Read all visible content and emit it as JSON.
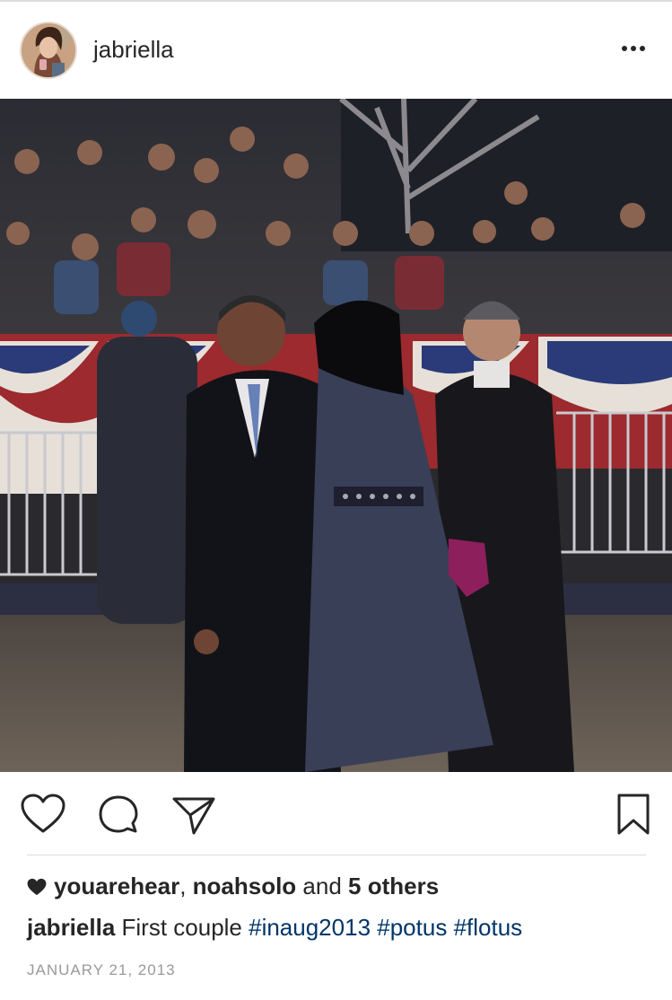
{
  "post": {
    "username": "jabriella",
    "more_label": "•••",
    "likes": {
      "user1": "youarehear",
      "separator": ", ",
      "user2": "noahsolo",
      "and_text": " and ",
      "others": "5 others"
    },
    "caption": {
      "username": "jabriella",
      "text": " First couple ",
      "hashtags": [
        "#inaug2013",
        "#potus",
        "#flotus"
      ]
    },
    "date": "JANUARY 21, 2013"
  },
  "icons": {
    "more": "more-dots-icon",
    "like": "heart-icon",
    "comment": "comment-bubble-icon",
    "share": "paper-plane-icon",
    "save": "bookmark-icon",
    "liked": "filled-heart-icon"
  },
  "colors": {
    "text": "#262626",
    "hashtag": "#003569",
    "date": "#999999",
    "divider": "#dbdbdb"
  }
}
